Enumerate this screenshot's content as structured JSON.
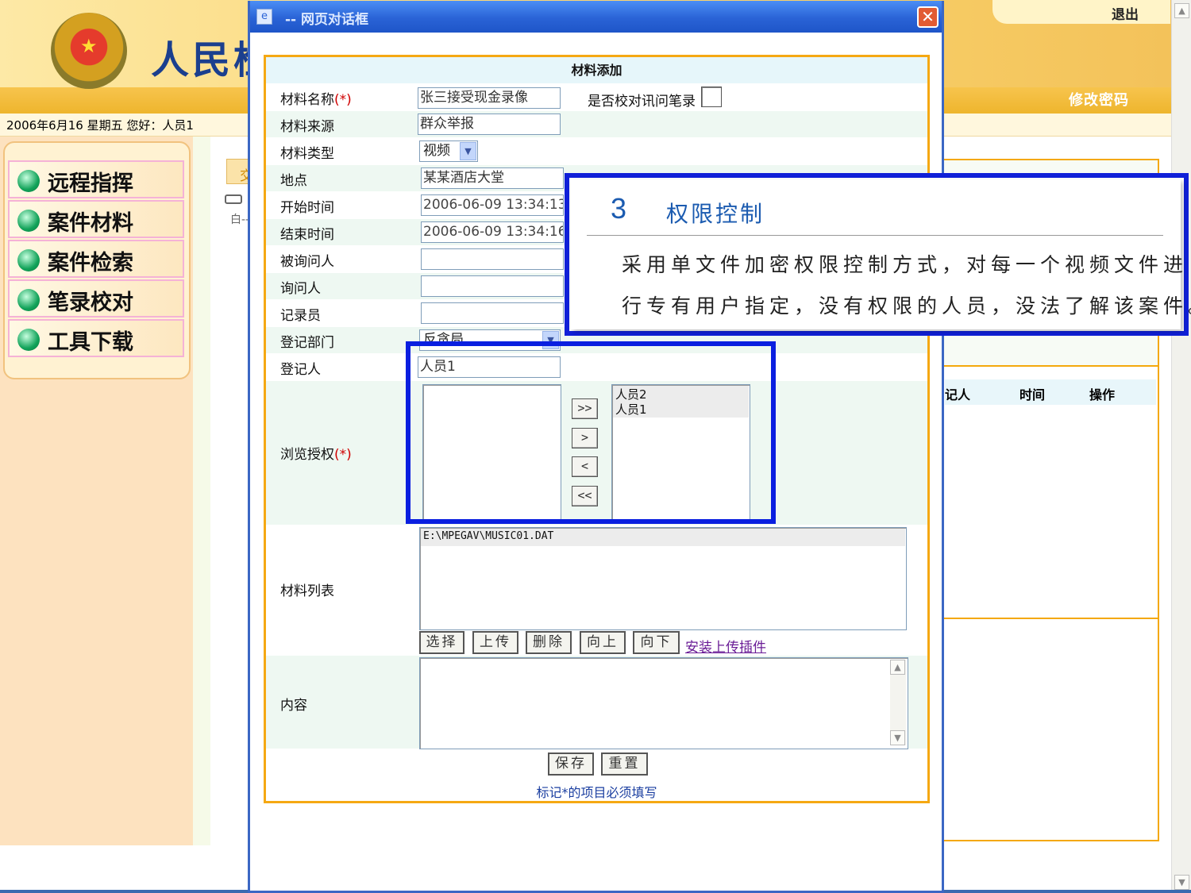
{
  "header": {
    "site_title": "人民检",
    "emblem_glyph": "★",
    "logout": "退出",
    "change_password": "修改密码"
  },
  "datebar": {
    "text": "2006年6月16  星期五    您好：人员1"
  },
  "sidebar": {
    "items": [
      {
        "label": "远程指挥"
      },
      {
        "label": "案件材料"
      },
      {
        "label": "案件检索"
      },
      {
        "label": "笔录校对"
      },
      {
        "label": "工具下载"
      }
    ]
  },
  "main": {
    "breadcrumb_fragment": "交",
    "tree_fragment": "白---"
  },
  "right_table": {
    "headers": [
      "记人",
      "时间",
      "操作"
    ]
  },
  "dialog": {
    "title": "-- 网页对话框",
    "close_glyph": "✕",
    "form_title": "材料添加",
    "fields": {
      "name_label": "材料名称",
      "required_mark": "(*)",
      "name_value": "张三接受现金录像",
      "proofread_label": "是否校对讯问笔录",
      "source_label": "材料来源",
      "source_value": "群众举报",
      "type_label": "材料类型",
      "type_value": "视频",
      "location_label": "地点",
      "location_value": "某某酒店大堂",
      "start_label": "开始时间",
      "start_value": "2006-06-09 13:34:13",
      "end_label": "结束时间",
      "end_value": "2006-06-09 13:34:16",
      "interviewee_label": "被询问人",
      "interviewee_value": "",
      "interviewer_label": "询问人",
      "interviewer_value": "",
      "recorder_label": "记录员",
      "recorder_value": "",
      "dept_label": "登记部门",
      "dept_value": "反贪局",
      "registrant_label": "登记人",
      "registrant_value": "人员1",
      "auth_label": "浏览授权",
      "auth_available": [],
      "auth_selected": [
        "人员2",
        "人员1"
      ],
      "move_all_right": ">>",
      "move_right": ">",
      "move_left": "<",
      "move_all_left": "<<",
      "files_label": "材料列表",
      "files": [
        "E:\\MPEGAV\\MUSIC01.DAT"
      ],
      "content_label": "内容",
      "content_value": ""
    },
    "file_buttons": {
      "choose": "选择",
      "upload": "上传",
      "delete": "删除",
      "up": "向上",
      "down": "向下"
    },
    "install_link": "安装上传插件",
    "save": "保存",
    "reset": "重置",
    "required_hint": "标记*的项目必须填写"
  },
  "callout": {
    "number": "3",
    "title": "权限控制",
    "line1": "采用单文件加密权限控制方式，对每一个视频文件进",
    "line2": "行专有用户指定，没有权限的人员，没法了解该案件。"
  },
  "colors": {
    "accent_blue": "#0a1fe0",
    "form_border": "#f5a813",
    "titlebar": "#2a63d6",
    "required": "#d00000"
  }
}
